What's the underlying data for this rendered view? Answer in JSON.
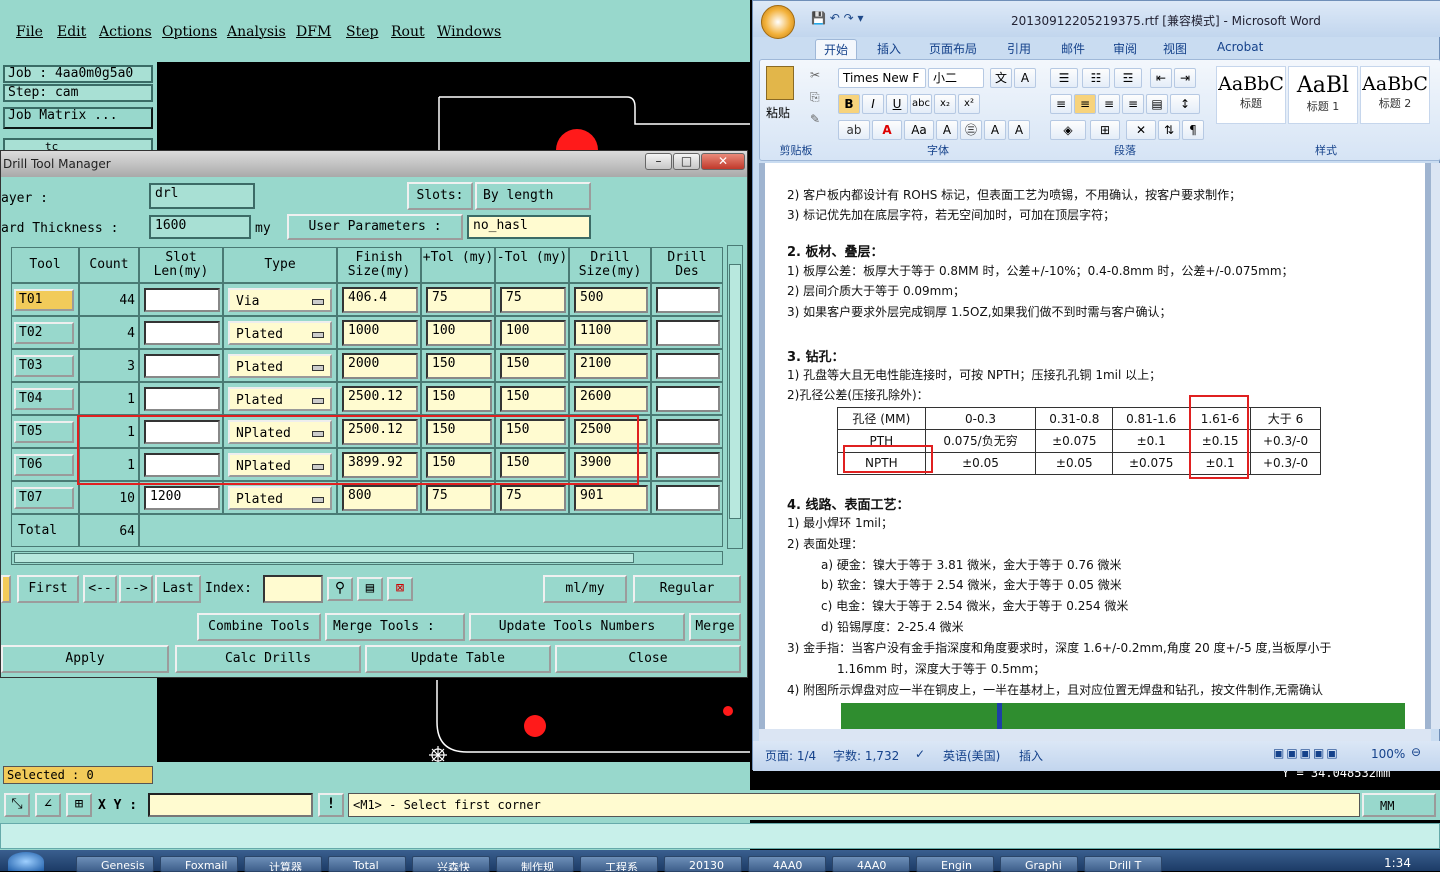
{
  "genesis": {
    "menu": [
      "File",
      "Edit",
      "Actions",
      "Options",
      "Analysis",
      "DFM",
      "Step",
      "Rout",
      "Windows"
    ],
    "job_label": "Job : 4aa0m0g5a0",
    "step_label": "Step: cam",
    "job_matrix_button": "Job Matrix ...",
    "layer_small": "tc",
    "selected_label": "Selected : 0",
    "xy_label": "X Y :",
    "status_message": "<M1> - Select first corner",
    "unit_button": "MM",
    "coord_readout": "Y = 34.048532mm"
  },
  "drill_tool_manager": {
    "title": "Drill Tool Manager",
    "layer_label": "ayer :",
    "layer_value": "drl",
    "slots_label": "Slots:",
    "slots_value": "By length",
    "board_thickness_label": "ard Thickness :",
    "board_thickness_value": "1600",
    "thickness_unit": "my",
    "user_params_label": "User Parameters :",
    "user_params_value": "no_hasl",
    "columns": [
      "Tool",
      "Count",
      "Slot Len(my)",
      "Type",
      "Finish Size(my)",
      "+Tol (my)",
      "-Tol (my)",
      "Drill Size(my)",
      "Drill Des"
    ],
    "rows": [
      {
        "tool": "T01",
        "count": "44",
        "slot": "",
        "type": "Via",
        "finish": "406.4",
        "ptol": "75",
        "mtol": "75",
        "drill": "500",
        "des": ""
      },
      {
        "tool": "T02",
        "count": "4",
        "slot": "",
        "type": "Plated",
        "finish": "1000",
        "ptol": "100",
        "mtol": "100",
        "drill": "1100",
        "des": ""
      },
      {
        "tool": "T03",
        "count": "3",
        "slot": "",
        "type": "Plated",
        "finish": "2000",
        "ptol": "150",
        "mtol": "150",
        "drill": "2100",
        "des": ""
      },
      {
        "tool": "T04",
        "count": "1",
        "slot": "",
        "type": "Plated",
        "finish": "2500.12",
        "ptol": "150",
        "mtol": "150",
        "drill": "2600",
        "des": ""
      },
      {
        "tool": "T05",
        "count": "1",
        "slot": "",
        "type": "NPlated",
        "finish": "2500.12",
        "ptol": "150",
        "mtol": "150",
        "drill": "2500",
        "des": ""
      },
      {
        "tool": "T06",
        "count": "1",
        "slot": "",
        "type": "NPlated",
        "finish": "3899.92",
        "ptol": "150",
        "mtol": "150",
        "drill": "3900",
        "des": ""
      },
      {
        "tool": "T07",
        "count": "10",
        "slot": "1200",
        "type": "Plated",
        "finish": "800",
        "ptol": "75",
        "mtol": "75",
        "drill": "901",
        "des": ""
      }
    ],
    "total_label": "Total",
    "total_count": "64",
    "nav": {
      "first": "First",
      "prev": "<--",
      "next": "-->",
      "last": "Last",
      "index_label": "Index:",
      "unit_select": "ml/my",
      "mode_select": "Regular"
    },
    "actions1": {
      "combine": "Combine Tools",
      "merge_tools": "Merge Tools :",
      "update_numbers": "Update Tools Numbers",
      "merge": "Merge"
    },
    "actions2": {
      "apply": "Apply",
      "calc": "Calc Drills",
      "update_table": "Update Table",
      "close": "Close"
    }
  },
  "word": {
    "title": "20130912205219375.rtf [兼容模式] - Microsoft Word",
    "tabs": [
      "开始",
      "插入",
      "页面布局",
      "引用",
      "邮件",
      "审阅",
      "视图",
      "Acrobat"
    ],
    "paste_label": "粘贴",
    "clipboard_label": "剪贴板",
    "font_name": "Times New F",
    "font_size": "小二",
    "font_group": "字体",
    "para_group": "段落",
    "styles_group": "样式",
    "styles": [
      {
        "preview": "AaBbC",
        "name": "标题"
      },
      {
        "preview": "AaBl",
        "name": "标题 1"
      },
      {
        "preview": "AaBbC",
        "name": "标题 2"
      }
    ],
    "doc_lines": [
      "2) 客户板内都设计有 ROHS 标记，但表面工艺为喷锡，不用确认，按客户要求制作；",
      "3) 标记优先加在底层字符，若无空间加时，可加在顶层字符；",
      "2.  板材、叠层：",
      "1) 板厚公差：板厚大于等于 0.8MM 时，公差+/-10%；0.4-0.8mm 时，公差+/-0.075mm；",
      "2) 层间介质大于等于 0.09mm；",
      "3) 如果客户要求外层完成铜厚 1.5OZ,如果我们做不到时需与客户确认；",
      "3.  钻孔：",
      "1) 孔盘等大且无电性能连接时，可按 NPTH；压接孔孔铜 1mil 以上；",
      "2)孔径公差(压接孔除外)：",
      "4.  线路、表面工艺：",
      "1) 最小焊环 1mil；",
      "2) 表面处理：",
      "a) 硬金：镍大于等于 3.81 微米，金大于等于 0.76 微米",
      "b) 软金：镍大于等于 2.54 微米，金大于等于 0.05 微米",
      "c) 电金：镍大于等于 2.54 微米，金大于等于 0.254 微米",
      "d) 铅锡厚度：2-25.4 微米",
      "3) 金手指：当客户没有金手指深度和角度要求时，深度 1.6+/-0.2mm,角度 20 度+/-5 度,当板厚小于",
      "1.16mm 时，深度大于等于 0.5mm；",
      "4) 附图所示焊盘对应一半在铜皮上，一半在基材上，且对应位置无焊盘和钻孔，按文件制作,无需确认"
    ],
    "table": [
      [
        "孔径 (MM)",
        "0-0.3",
        "0.31-0.8",
        "0.81-1.6",
        "1.61-6",
        "大于 6"
      ],
      [
        "PTH",
        "0.075/负无穷",
        "±0.075",
        "±0.1",
        "±0.15",
        "+0.3/-0"
      ],
      [
        "NPTH",
        "±0.05",
        "±0.05",
        "±0.075",
        "±0.1",
        "+0.3/-0"
      ]
    ],
    "status": {
      "page": "页面: 1/4",
      "words": "字数: 1,732",
      "lang": "英语(美国)",
      "mode": "插入",
      "zoom": "100%"
    }
  },
  "taskbar": {
    "items": [
      "Genesis",
      "Foxmail",
      "计算器",
      "Total",
      "兴森快",
      "制作规",
      "工程系",
      "20130",
      "4AA0",
      "4AA0",
      "Engin",
      "Graphi",
      "Drill T"
    ],
    "clock": "1:34"
  }
}
